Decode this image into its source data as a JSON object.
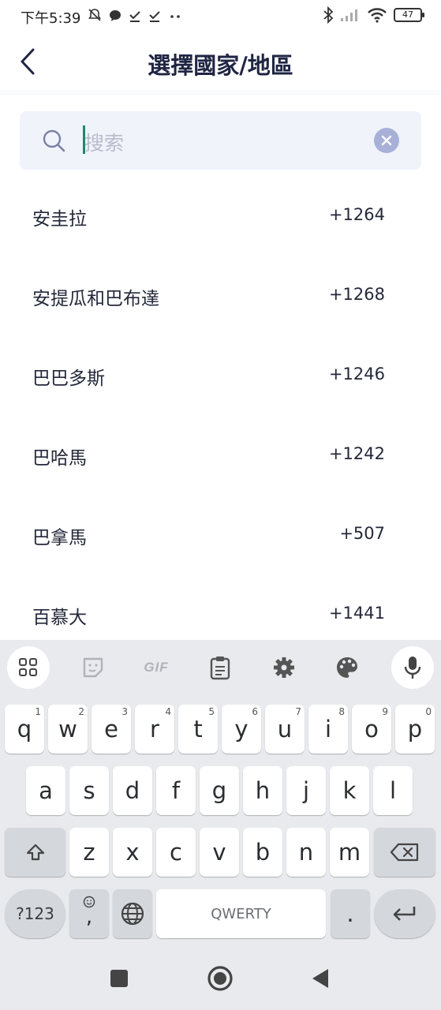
{
  "status_bar": {
    "time": "下午5:39",
    "left_icons": [
      "bell-off-icon",
      "chat-icon",
      "check-icon",
      "check-icon",
      "more-dots-icon"
    ],
    "right_icons": [
      "bluetooth-icon",
      "signal-icon",
      "wifi-icon"
    ],
    "battery": "47"
  },
  "header": {
    "title": "選擇國家/地區"
  },
  "search": {
    "placeholder": "搜索"
  },
  "countries": [
    {
      "name": "安圭拉",
      "code": "+1264"
    },
    {
      "name": "安提瓜和巴布達",
      "code": "+1268"
    },
    {
      "name": "巴巴多斯",
      "code": "+1246"
    },
    {
      "name": "巴哈馬",
      "code": "+1242"
    },
    {
      "name": "巴拿馬",
      "code": "+507"
    },
    {
      "name": "百慕大",
      "code": "+1441"
    }
  ],
  "keyboard": {
    "toolbar_gif": "GIF",
    "row1": [
      {
        "key": "q",
        "hint": "1"
      },
      {
        "key": "w",
        "hint": "2"
      },
      {
        "key": "e",
        "hint": "3"
      },
      {
        "key": "r",
        "hint": "4"
      },
      {
        "key": "t",
        "hint": "5"
      },
      {
        "key": "y",
        "hint": "6"
      },
      {
        "key": "u",
        "hint": "7"
      },
      {
        "key": "i",
        "hint": "8"
      },
      {
        "key": "o",
        "hint": "9"
      },
      {
        "key": "p",
        "hint": "0"
      }
    ],
    "row2": [
      "a",
      "s",
      "d",
      "f",
      "g",
      "h",
      "j",
      "k",
      "l"
    ],
    "row3": [
      "z",
      "x",
      "c",
      "v",
      "b",
      "n",
      "m"
    ],
    "symbols_key": "?123",
    "comma_key": ",",
    "space_label": "QWERTY",
    "period_key": "."
  },
  "colors": {
    "accent": "#1a8a6a",
    "title": "#1f2543",
    "search_bg": "#f1f3fb",
    "clear_button": "#a9b0d8"
  }
}
